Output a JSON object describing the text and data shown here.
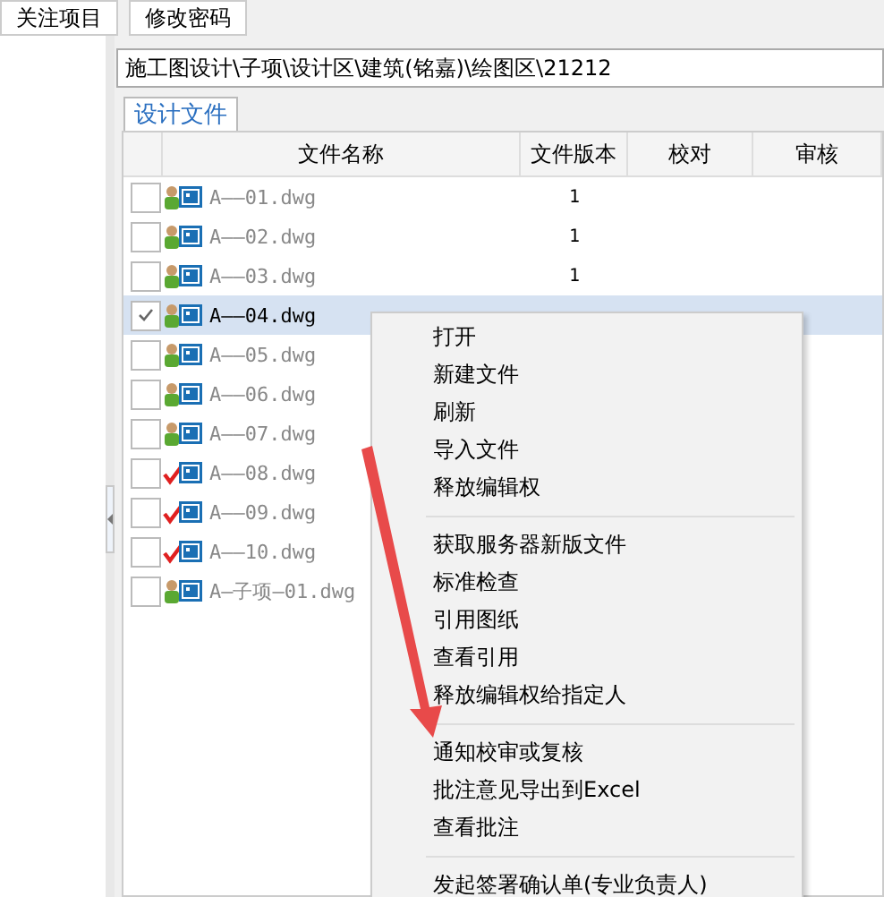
{
  "toolbar": {
    "buttons": [
      "关注项目",
      "修改密码"
    ]
  },
  "path": {
    "value": "施工图设计\\子项\\设计区\\建筑(铭嘉)\\绘图区\\21212"
  },
  "tabs": [
    {
      "label": "设计文件",
      "selected": true
    }
  ],
  "table": {
    "columns": [
      "文件名称",
      "文件版本",
      "校对",
      "审核"
    ],
    "rows": [
      {
        "checked": false,
        "selected": false,
        "kind": "owner",
        "name": "A——01.dwg",
        "version": "1"
      },
      {
        "checked": false,
        "selected": false,
        "kind": "owner",
        "name": "A——02.dwg",
        "version": "1"
      },
      {
        "checked": false,
        "selected": false,
        "kind": "owner",
        "name": "A——03.dwg",
        "version": "1"
      },
      {
        "checked": true,
        "selected": true,
        "kind": "owner",
        "name": "A——04.dwg"
      },
      {
        "checked": false,
        "selected": false,
        "kind": "owner",
        "name": "A——05.dwg"
      },
      {
        "checked": false,
        "selected": false,
        "kind": "owner",
        "name": "A——06.dwg"
      },
      {
        "checked": false,
        "selected": false,
        "kind": "owner",
        "name": "A——07.dwg"
      },
      {
        "checked": false,
        "selected": false,
        "kind": "approved",
        "name": "A——08.dwg"
      },
      {
        "checked": false,
        "selected": false,
        "kind": "approved",
        "name": "A——09.dwg"
      },
      {
        "checked": false,
        "selected": false,
        "kind": "approved",
        "name": "A——10.dwg"
      },
      {
        "checked": false,
        "selected": false,
        "kind": "owner",
        "name": "A—子项—01.dwg"
      }
    ]
  },
  "context_menu": {
    "groups": [
      [
        "打开",
        "新建文件",
        "刷新",
        "导入文件",
        "释放编辑权"
      ],
      [
        "获取服务器新版文件",
        "标准检查",
        "引用图纸",
        "查看引用",
        "释放编辑权给指定人"
      ],
      [
        "通知校审或复核",
        "批注意见导出到Excel",
        "查看批注"
      ],
      [
        "发起签署确认单(专业负责人)"
      ]
    ]
  }
}
